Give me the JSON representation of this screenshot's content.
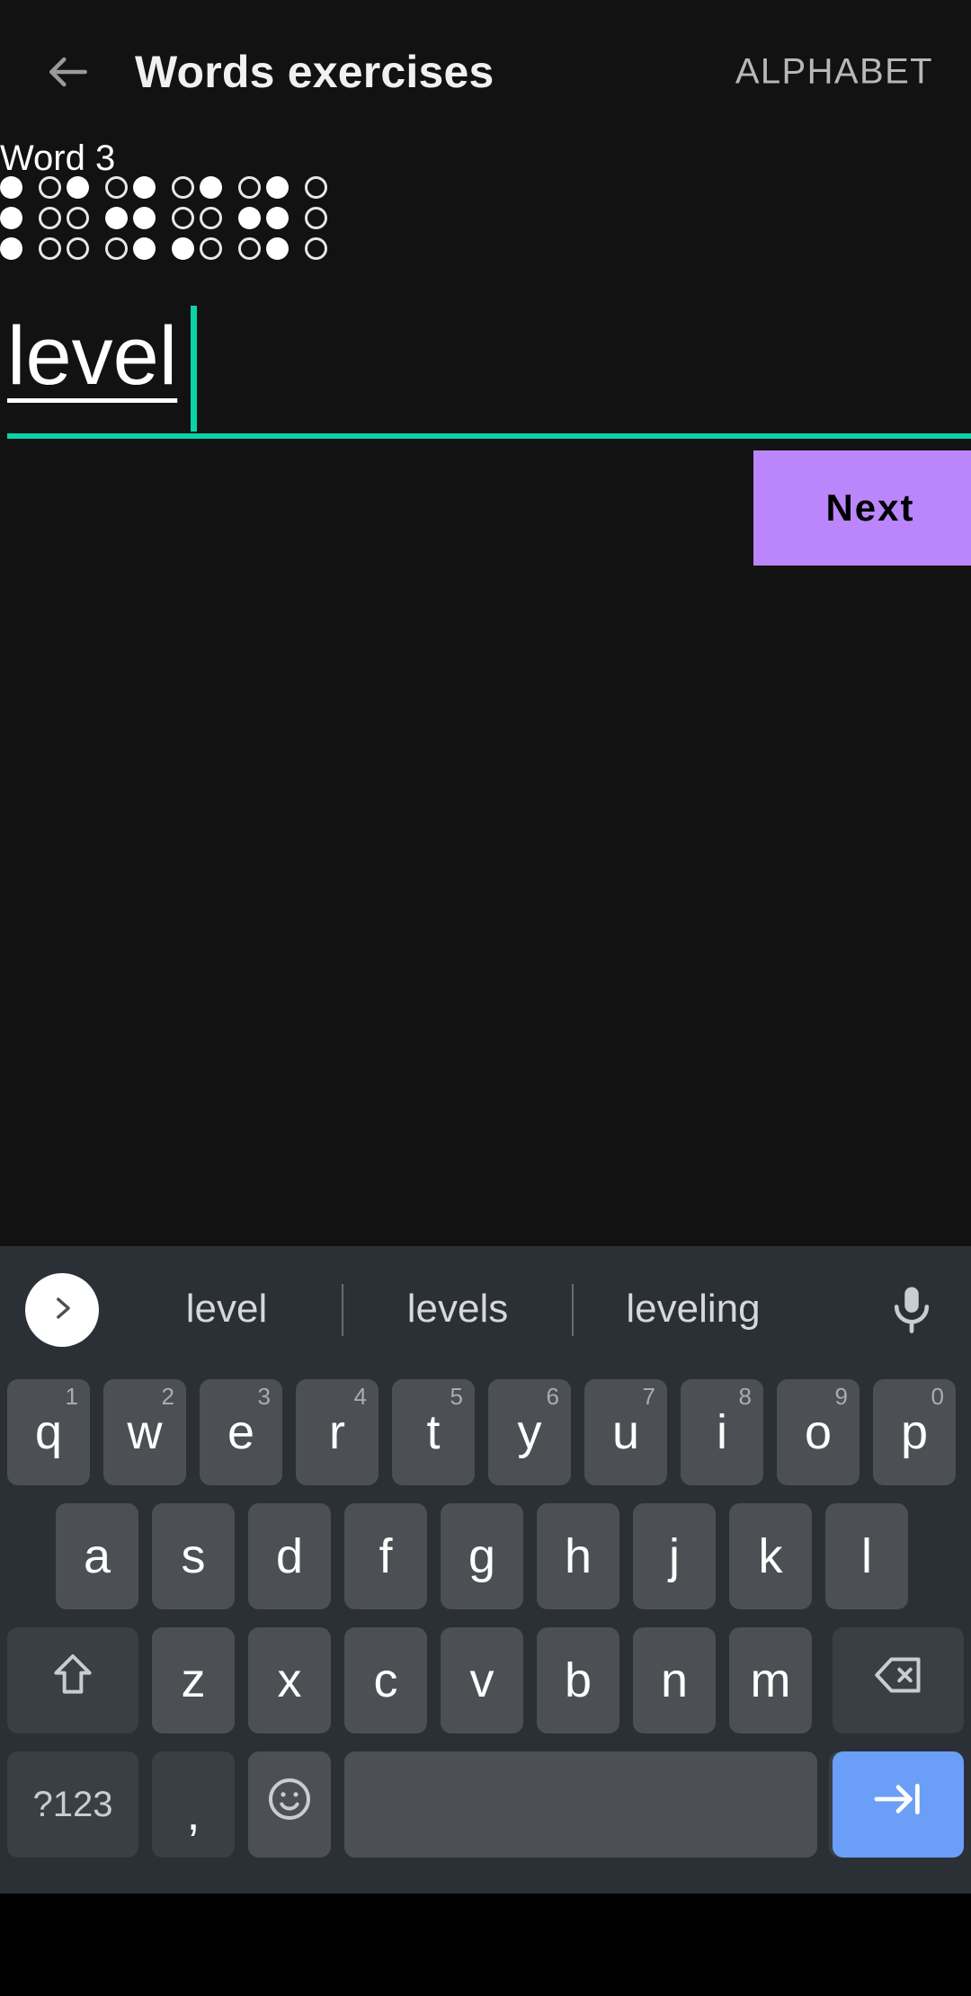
{
  "appbar": {
    "back_icon": "arrow-left-icon",
    "title": "Words exercises",
    "action_label": "ALPHABET"
  },
  "exercise": {
    "word_label": "Word 3",
    "answer_value": "level",
    "next_label": "Next",
    "accent_color": "#0ad3a8",
    "next_button_color": "#bb86fc",
    "braille_cells": [
      {
        "letter": "l",
        "dots": [
          1,
          1,
          1,
          0,
          0,
          0
        ]
      },
      {
        "letter": "e",
        "dots": [
          1,
          0,
          0,
          0,
          1,
          0
        ]
      },
      {
        "letter": "v",
        "dots": [
          1,
          1,
          1,
          0,
          0,
          1
        ]
      },
      {
        "letter": "e",
        "dots": [
          1,
          0,
          0,
          0,
          1,
          0
        ]
      },
      {
        "letter": "l",
        "dots": [
          1,
          1,
          1,
          0,
          0,
          0
        ]
      }
    ]
  },
  "keyboard": {
    "expand_icon": "chevron-right-icon",
    "mic_icon": "microphone-icon",
    "suggestions": [
      "level",
      "levels",
      "leveling"
    ],
    "row1": [
      {
        "label": "q",
        "sup": "1"
      },
      {
        "label": "w",
        "sup": "2"
      },
      {
        "label": "e",
        "sup": "3"
      },
      {
        "label": "r",
        "sup": "4"
      },
      {
        "label": "t",
        "sup": "5"
      },
      {
        "label": "y",
        "sup": "6"
      },
      {
        "label": "u",
        "sup": "7"
      },
      {
        "label": "i",
        "sup": "8"
      },
      {
        "label": "o",
        "sup": "9"
      },
      {
        "label": "p",
        "sup": "0"
      }
    ],
    "row2": [
      {
        "label": "a"
      },
      {
        "label": "s"
      },
      {
        "label": "d"
      },
      {
        "label": "f"
      },
      {
        "label": "g"
      },
      {
        "label": "h"
      },
      {
        "label": "j"
      },
      {
        "label": "k"
      },
      {
        "label": "l"
      }
    ],
    "row3": [
      {
        "label": "z"
      },
      {
        "label": "x"
      },
      {
        "label": "c"
      },
      {
        "label": "v"
      },
      {
        "label": "b"
      },
      {
        "label": "n"
      },
      {
        "label": "m"
      }
    ],
    "shift_icon": "shift-arrow-up-icon",
    "backspace_icon": "backspace-icon",
    "symbols_label": "?123",
    "comma_label": ",",
    "emoji_icon": "emoji-smiley-icon",
    "space_label": "",
    "period_label": ".",
    "enter_icon": "tab-next-arrow-icon",
    "enter_key_color": "#6b9ef7"
  }
}
